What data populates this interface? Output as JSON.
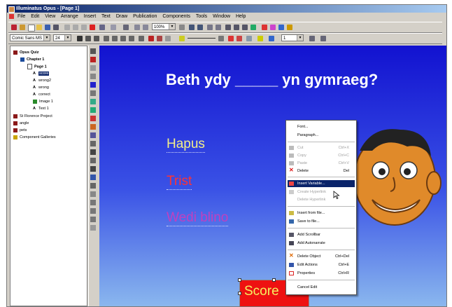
{
  "window": {
    "title": "Illuminatus Opus - [Page 1]"
  },
  "menubar": {
    "items": [
      "File",
      "Edit",
      "View",
      "Arrange",
      "Insert",
      "Text",
      "Draw",
      "Publication",
      "Components",
      "Tools",
      "Window",
      "Help"
    ]
  },
  "toolbar": {
    "zoom": "100%",
    "font": "Comic Sans MS",
    "size": "24",
    "spin": "1"
  },
  "tree": {
    "nodes": [
      {
        "label": "Opus Quiz",
        "bold": true,
        "color": "#8b1a1a"
      },
      {
        "label": "Chapter 1",
        "bold": true,
        "color": "#1a4a9b"
      },
      {
        "label": "Page 1",
        "bold": true,
        "color": "#ffffff"
      },
      {
        "label": "score",
        "icon": "A"
      },
      {
        "label": "wrong2",
        "icon": "A"
      },
      {
        "label": "wrong",
        "icon": "A"
      },
      {
        "label": "correct",
        "icon": "A"
      },
      {
        "label": "Image 1",
        "icon": "img"
      },
      {
        "label": "Text 1",
        "icon": "A"
      },
      {
        "label": "St Florence Project",
        "color": "#8b1a1a"
      },
      {
        "label": "angle",
        "color": "#8b1a1a"
      },
      {
        "label": "pets",
        "color": "#8b1a1a"
      },
      {
        "label": "Component Galleries",
        "color": "#c8a400"
      }
    ]
  },
  "canvas": {
    "question": "Beth ydy _____ yn gymraeg?",
    "answers": [
      "Hapus",
      "Trist",
      "Wedi blino"
    ],
    "score_label": "Score"
  },
  "context_menu": {
    "items": [
      {
        "label": "Font...",
        "shortcut": "",
        "state": "normal"
      },
      {
        "label": "Paragraph...",
        "shortcut": "",
        "state": "normal"
      },
      {
        "label": "Cut",
        "shortcut": "Ctrl+X",
        "state": "disabled"
      },
      {
        "label": "Copy",
        "shortcut": "Ctrl+C",
        "state": "disabled"
      },
      {
        "label": "Paste",
        "shortcut": "Ctrl+V",
        "state": "disabled"
      },
      {
        "label": "Delete",
        "shortcut": "Del",
        "state": "normal"
      },
      {
        "label": "Insert Variable...",
        "shortcut": "",
        "state": "selected"
      },
      {
        "label": "Create Hyperlink",
        "shortcut": "",
        "state": "disabled"
      },
      {
        "label": "Delete Hyperlink",
        "shortcut": "",
        "state": "disabled"
      },
      {
        "label": "Insert from file...",
        "shortcut": "",
        "state": "normal"
      },
      {
        "label": "Save to file...",
        "shortcut": "",
        "state": "normal"
      },
      {
        "label": "Add Scrollbar",
        "shortcut": "",
        "state": "normal"
      },
      {
        "label": "Add Autonarrate",
        "shortcut": "",
        "state": "normal"
      },
      {
        "label": "Delete Object",
        "shortcut": "Ctrl+Del",
        "state": "normal"
      },
      {
        "label": "Edit Actions",
        "shortcut": "Ctrl+E",
        "state": "normal"
      },
      {
        "label": "Properties",
        "shortcut": "Ctrl+R",
        "state": "normal"
      },
      {
        "label": "Cancel Edit",
        "shortcut": "",
        "state": "normal"
      }
    ]
  }
}
